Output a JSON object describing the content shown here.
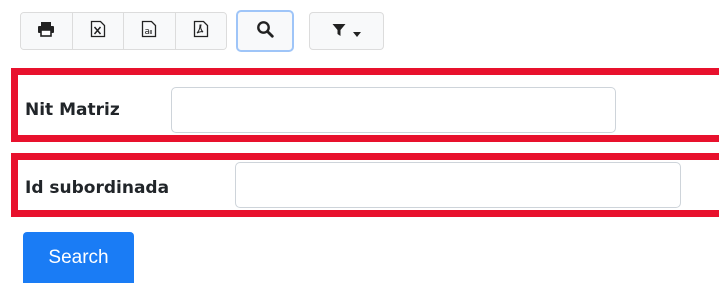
{
  "toolbar": {
    "export_buttons": [
      {
        "icon": "print-icon"
      },
      {
        "icon": "excel-icon"
      },
      {
        "icon": "text-file-icon"
      },
      {
        "icon": "pdf-icon"
      }
    ],
    "search_toggle_icon": "search-icon",
    "filter_icon": "filter-icon",
    "filter_caret_icon": "caret-down-icon"
  },
  "form": {
    "fields": [
      {
        "label": "Nit Matriz",
        "value": "",
        "placeholder": ""
      },
      {
        "label": "Id subordinada",
        "value": "",
        "placeholder": ""
      }
    ],
    "highlight_color": "#e8112d"
  },
  "search_button": {
    "label": "Search",
    "color": "#1a7cf5"
  }
}
